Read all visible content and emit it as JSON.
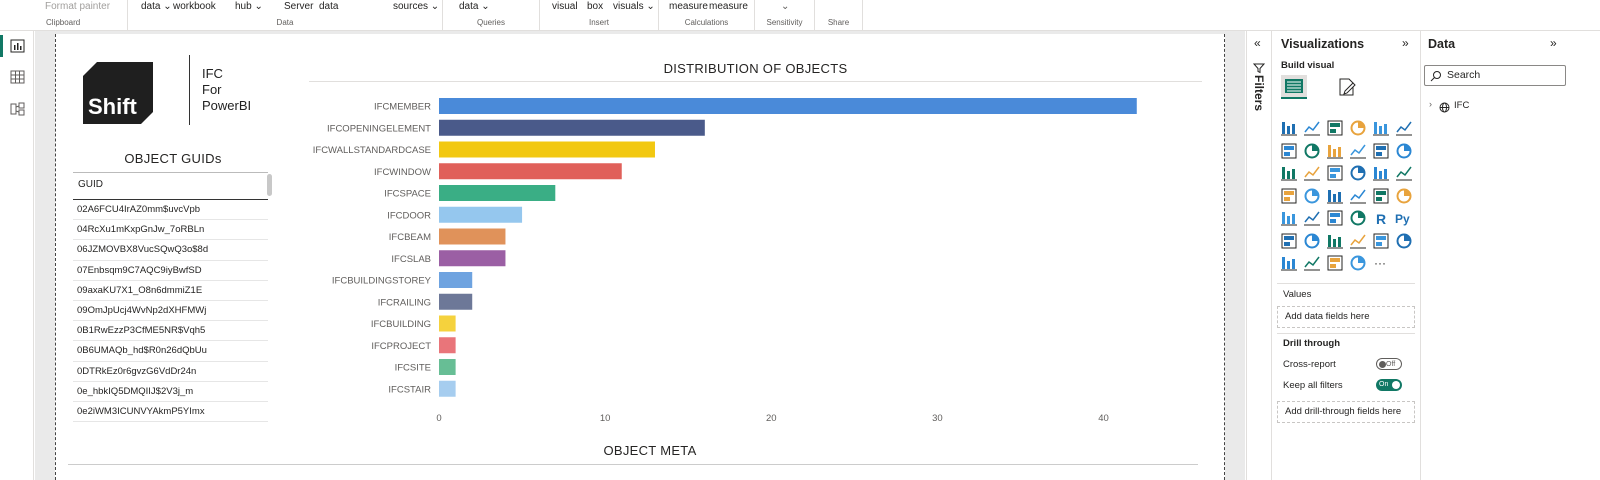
{
  "ribbon": {
    "groups": [
      {
        "label": "Clipboard",
        "items": [
          "Format painter"
        ]
      },
      {
        "label": "Data",
        "items": [
          "data ⌄",
          "workbook",
          "hub ⌄",
          "Server",
          "data",
          "sources ⌄"
        ]
      },
      {
        "label": "Queries",
        "items": [
          "data ⌄"
        ]
      },
      {
        "label": "Insert",
        "items": [
          "visual",
          "box",
          "visuals ⌄"
        ]
      },
      {
        "label": "Calculations",
        "items": [
          "measure",
          "measure"
        ]
      },
      {
        "label": "Sensitivity",
        "items": [
          "⌄"
        ]
      },
      {
        "label": "Share",
        "items": []
      }
    ]
  },
  "logo": {
    "brand": "Shift",
    "lines": [
      "IFC",
      "For",
      "PowerBI"
    ]
  },
  "guid_table": {
    "title": "OBJECT GUIDs",
    "header": "GUID",
    "rows": [
      "02A6FCU4IrAZ0mm$uvcVpb",
      "04RcXu1mKxpGnJw_7oRBLn",
      "06JZMOVBX8VucSQwQ3o$8d",
      "07Enbsqm9C7AQC9iyBwfSD",
      "09axaKU7X1_O8n6dmmiZ1E",
      "09OmJpUcj4WvNp2dXHFMWj",
      "0B1RwEzzP3CfME5NR$Vqh5",
      "0B6UMAQb_hd$R0n26dQbUu",
      "0DTRkEz0r6gvzG6VdDr24n",
      "0e_hbkIQ5DMQIIJ$2V3j_m",
      "0e2iWM3ICUNVYAkmP5YImx"
    ]
  },
  "chart_data": {
    "type": "bar",
    "orientation": "horizontal",
    "title": "DISTRIBUTION OF OBJECTS",
    "categories": [
      "IFCMEMBER",
      "IFCOPENINGELEMENT",
      "IFCWALLSTANDARDCASE",
      "IFCWINDOW",
      "IFCSPACE",
      "IFCDOOR",
      "IFCBEAM",
      "IFCSLAB",
      "IFCBUILDINGSTOREY",
      "IFCRAILING",
      "IFCBUILDING",
      "IFCPROJECT",
      "IFCSITE",
      "IFCSTAIR"
    ],
    "values": [
      42,
      16,
      13,
      11,
      7,
      5,
      4,
      4,
      2,
      2,
      1,
      1,
      1,
      1
    ],
    "colors": [
      "#4a8ad9",
      "#4a5a8a",
      "#f2c811",
      "#e0605a",
      "#3aae85",
      "#95c7ee",
      "#e0925a",
      "#9b5fa4",
      "#6ea3e0",
      "#6d7898",
      "#f5d23d",
      "#e9757a",
      "#67be95",
      "#a6cdef"
    ],
    "xticks": [
      0,
      10,
      20,
      30,
      40
    ],
    "xlim": [
      0,
      44
    ],
    "grid": false,
    "legend": "none"
  },
  "meta": {
    "title": "OBJECT META"
  },
  "filters": {
    "label": "Filters"
  },
  "visualizations": {
    "title": "Visualizations",
    "build_label": "Build visual",
    "values_label": "Values",
    "values_placeholder": "Add data fields here",
    "drill_label": "Drill through",
    "cross_report_label": "Cross-report",
    "cross_report_state": "Off",
    "keep_filters_label": "Keep all filters",
    "keep_filters_state": "On",
    "drill_placeholder": "Add drill-through fields here",
    "more_label": "···"
  },
  "data_pane": {
    "title": "Data",
    "search_placeholder": "Search",
    "tables": [
      "IFC"
    ]
  }
}
